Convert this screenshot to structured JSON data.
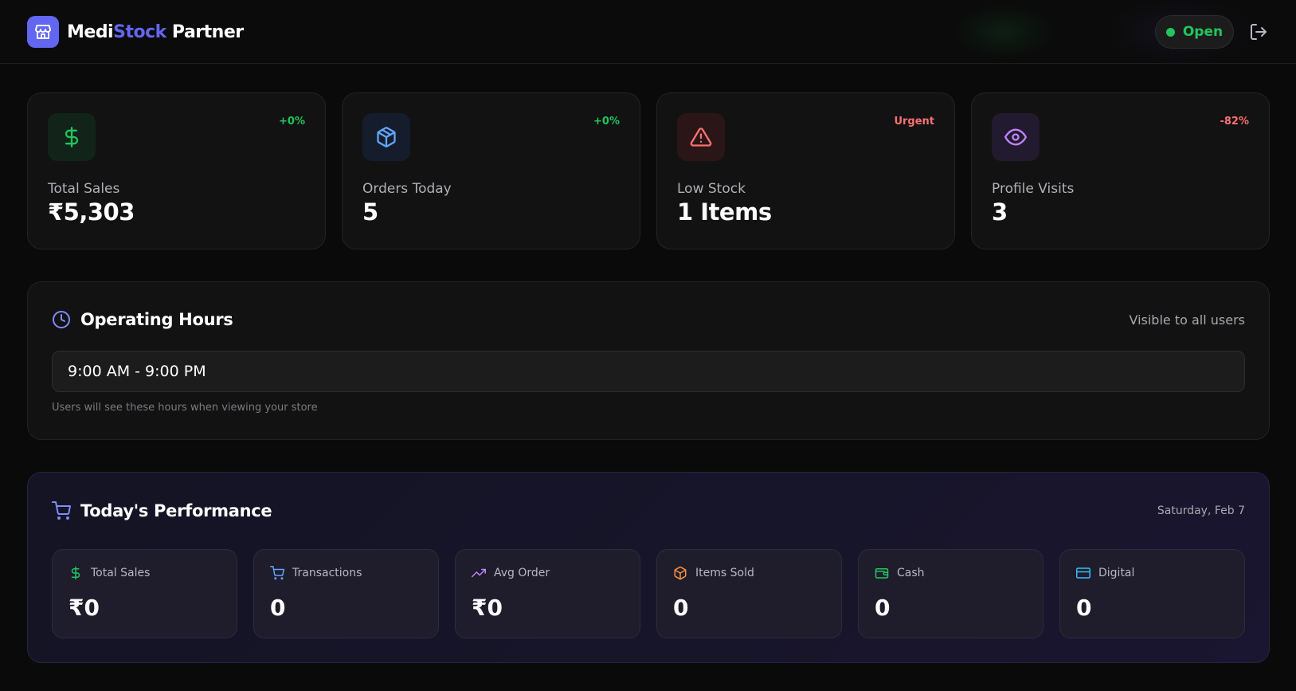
{
  "header": {
    "brand_part1": "Medi",
    "brand_part2": "Stock",
    "brand_part3": " Partner",
    "status_label": "Open"
  },
  "stats": [
    {
      "label": "Total Sales",
      "value": "₹5,303",
      "trend": "+0%",
      "icon": "dollar-icon",
      "trend_color": "#22c55e"
    },
    {
      "label": "Orders Today",
      "value": "5",
      "trend": "+0%",
      "icon": "package-icon",
      "trend_color": "#22c55e"
    },
    {
      "label": "Low Stock",
      "value": "1 Items",
      "trend": "Urgent",
      "icon": "alert-triangle-icon",
      "trend_color": "#f87171"
    },
    {
      "label": "Profile Visits",
      "value": "3",
      "trend": "-82%",
      "icon": "eye-icon",
      "trend_color": "#f87171"
    }
  ],
  "hours": {
    "title": "Operating Hours",
    "visibility_note": "Visible to all users",
    "value": "9:00 AM - 9:00 PM",
    "help_text": "Users will see these hours when viewing your store"
  },
  "performance": {
    "title": "Today's Performance",
    "date": "Saturday, Feb 7",
    "metrics": [
      {
        "label": "Total Sales",
        "value": "₹0",
        "icon": "dollar-icon"
      },
      {
        "label": "Transactions",
        "value": "0",
        "icon": "cart-icon"
      },
      {
        "label": "Avg Order",
        "value": "₹0",
        "icon": "trending-up-icon"
      },
      {
        "label": "Items Sold",
        "value": "0",
        "icon": "package-icon"
      },
      {
        "label": "Cash",
        "value": "0",
        "icon": "wallet-icon"
      },
      {
        "label": "Digital",
        "value": "0",
        "icon": "credit-card-icon"
      }
    ]
  },
  "colors": {
    "accent": "#6366f1",
    "success": "#22c55e",
    "danger": "#f87171",
    "background": "#0a0a0a"
  }
}
